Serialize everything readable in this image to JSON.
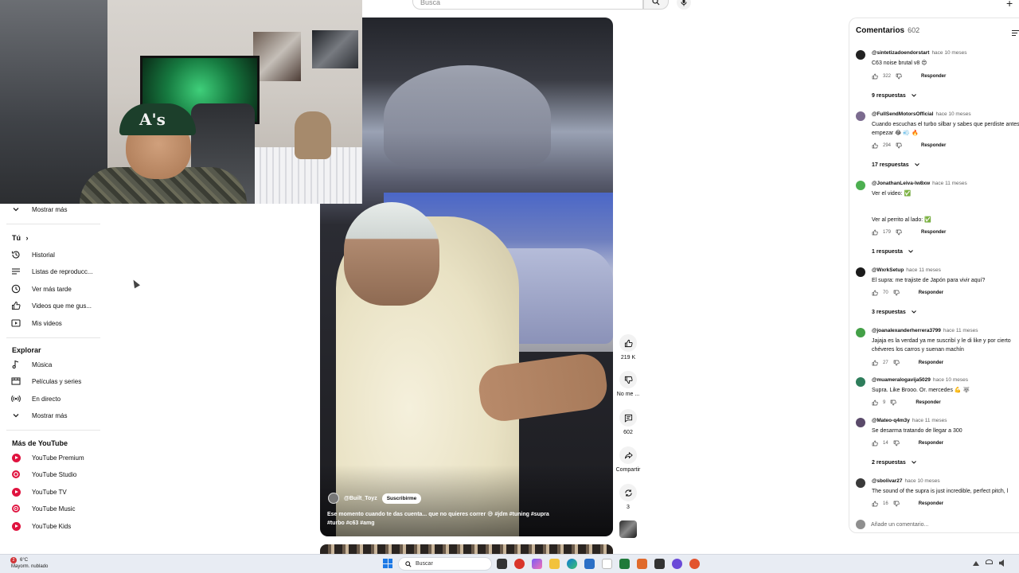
{
  "header": {
    "search_placeholder": "Busca"
  },
  "sidebar": {
    "show_more_top": "Mostrar más",
    "you_label": "Tú",
    "you_chevron": "›",
    "you_items": [
      {
        "label": "Historial",
        "icon": "history-icon"
      },
      {
        "label": "Listas de reproducc...",
        "icon": "playlist-icon"
      },
      {
        "label": "Ver más tarde",
        "icon": "clock-icon"
      },
      {
        "label": "Videos que me gus...",
        "icon": "thumb-up-icon"
      },
      {
        "label": "Mis videos",
        "icon": "my-videos-icon"
      }
    ],
    "explore_label": "Explorar",
    "explore_items": [
      {
        "label": "Música",
        "icon": "music-note-icon"
      },
      {
        "label": "Películas y series",
        "icon": "film-icon"
      },
      {
        "label": "En directo",
        "icon": "live-icon"
      },
      {
        "label": "Mostrar más",
        "icon": "chevron-down-icon"
      }
    ],
    "more_label": "Más de YouTube",
    "more_items": [
      {
        "label": "YouTube Premium"
      },
      {
        "label": "YouTube Studio"
      },
      {
        "label": "YouTube TV"
      },
      {
        "label": "YouTube Music"
      },
      {
        "label": "YouTube Kids"
      }
    ]
  },
  "video": {
    "channel": "@Built_Toyz",
    "subscribe_label": "Suscribirme",
    "title": "Ese momento cuando te das cuenta... que no quieres correr 😅 #jdm #tuning #supra #turbo #c63 #amg"
  },
  "actions": {
    "likes": "219 K",
    "dislike_label": "No me ...",
    "comments": "602",
    "share_label": "Compartir",
    "remix": "3"
  },
  "comments": {
    "title": "Comentarios",
    "count": "602",
    "add_placeholder": "Añade un comentario...",
    "reply_label": "Responder",
    "items": [
      {
        "author": "@sintetizadoendorstart",
        "time": "hace 10 meses",
        "text": "C63 noise brutal v8 😍",
        "likes": "322",
        "replies": "9 respuestas",
        "avatar_color": "#222222"
      },
      {
        "author": "@FullSendMotorsOfficial",
        "time": "hace 10 meses",
        "text": "Cuando escuchas el turbo silbar y sabes que perdiste antes de\nempezar 😂 💨 🔥",
        "likes": "294",
        "replies": "17 respuestas",
        "avatar_color": "#7b6b8f"
      },
      {
        "author": "@JonathanLeiva-lw8xw",
        "time": "hace 11 meses",
        "text": "Ver el video: ✅\n\n\nVer al perrito al lado: ✅",
        "likes": "179",
        "replies": "1 respuesta",
        "avatar_color": "#4caf50"
      },
      {
        "author": "@WxrkSetup",
        "time": "hace 11 meses",
        "text": "El supra: me trajiste de Japón para vivir aquí?",
        "likes": "70",
        "replies": "3 respuestas",
        "avatar_color": "#1a1a1a"
      },
      {
        "author": "@joanalexanderherrera3799",
        "time": "hace 11 meses",
        "text": "Jajaja es la verdad ya me suscribí y le di like y por cierto\nchéveres los carros y suenan machín",
        "likes": "27",
        "replies": "",
        "avatar_color": "#43a047"
      },
      {
        "author": "@muameralogavija5029",
        "time": "hace 10 meses",
        "text": "Supra. Like Brooo. Or. mercedes 💪 🐺",
        "likes": "9",
        "replies": "",
        "avatar_color": "#2e7d5b"
      },
      {
        "author": "@Mateo-q4m3y",
        "time": "hace 11 meses",
        "text": "Se desarma tratando de llegar a 300",
        "likes": "14",
        "replies": "2 respuestas",
        "avatar_color": "#5a4a6a"
      },
      {
        "author": "@sbolivar27",
        "time": "hace 10 meses",
        "text": "The sound of the supra is just incredible, perfect pitch, l",
        "likes": "16",
        "replies": "",
        "avatar_color": "#3a3a3a"
      }
    ]
  },
  "taskbar": {
    "weather_temp": "6°C",
    "weather_desc": "Mayorm. nublado",
    "notification_count": "2",
    "search_label": "Buscar"
  }
}
